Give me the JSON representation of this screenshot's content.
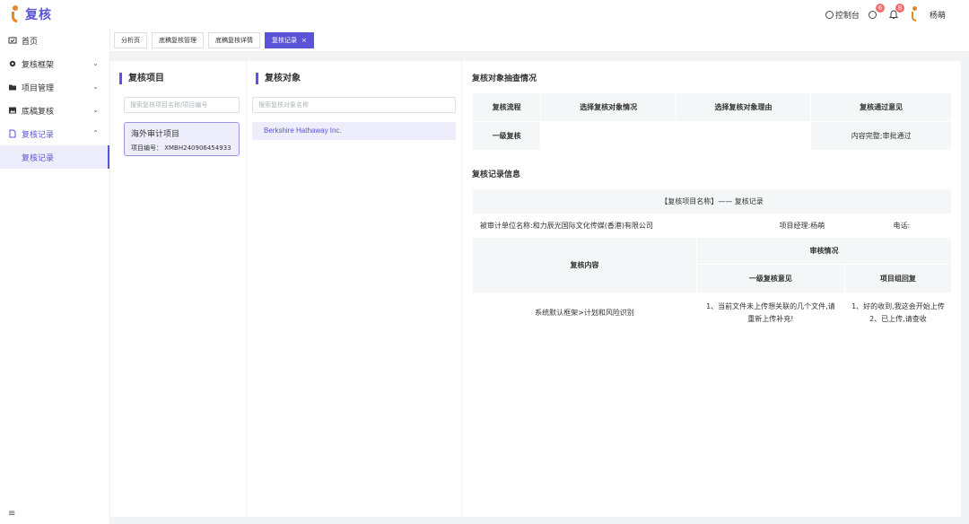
{
  "header": {
    "logo_text": "复核",
    "console_label": "控制台",
    "clock_badge": "6",
    "bell_badge": "8",
    "user_name": "杨萌"
  },
  "sidebar": {
    "items": [
      {
        "label": "首页"
      },
      {
        "label": "复核框架"
      },
      {
        "label": "项目管理"
      },
      {
        "label": "底稿复核"
      },
      {
        "label": "复核记录"
      }
    ],
    "sub_items": [
      {
        "label": "复核记录"
      }
    ]
  },
  "tabs": [
    {
      "label": "分析页"
    },
    {
      "label": "底稿复核管理"
    },
    {
      "label": "底稿复核详情"
    },
    {
      "label": "复核记录",
      "close": "×"
    }
  ],
  "projects_panel": {
    "title": "复核项目",
    "search_placeholder": "搜索复核项目名称/项目编号",
    "project_name": "海外审计项目",
    "project_code": "项目编号： XMBH240906454933"
  },
  "objects_panel": {
    "title": "复核对象",
    "search_placeholder": "搜索复核对象名称",
    "object_name": "Berkshire Hathaway Inc."
  },
  "detail": {
    "inspection_title": "复核对象抽查情况",
    "inspection_table": {
      "headers": [
        "复核流程",
        "选择复核对象情况",
        "选择复核对象理由",
        "复核通过意见"
      ],
      "row": [
        "一级复核",
        "",
        "",
        "内容完整;审批通过"
      ]
    },
    "record_title": "复核记录信息",
    "record_table": {
      "caption": "【复核项目名称】—— 复核记录",
      "unit_label": "被审计单位名称:和力辰光国际文化传媒(香港)有限公司",
      "manager_label": "项目经理:杨萌",
      "phone_label": "电话:",
      "content_header": "复核内容",
      "review_header": "审核情况",
      "level1_header": "一级复核意见",
      "reply_header": "项目组回复",
      "content_value": "系统默认框架>计划和风险识别",
      "level1_line1": "1、当前文件未上传想关联的几个文件,请",
      "level1_line2": "重新上传补充!",
      "reply_line1": "1、好的收到,我这会开始上传",
      "reply_line2": "2、已上传,请查收"
    }
  }
}
